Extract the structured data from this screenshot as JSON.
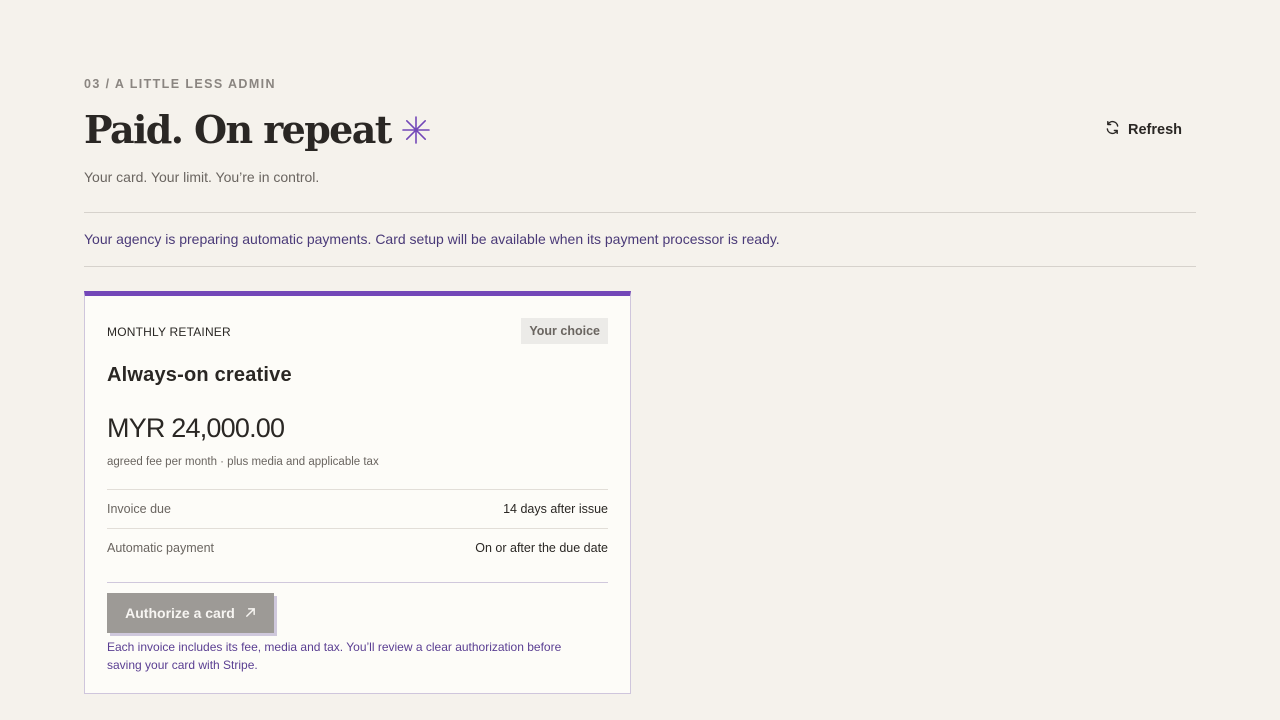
{
  "header": {
    "eyebrow": "03 / A LITTLE LESS ADMIN",
    "title": "Paid. On repeat",
    "title_icon": "asterisk-icon",
    "subtitle": "Your card. Your limit. You’re in control.",
    "refresh_label": "Refresh",
    "refresh_icon": "refresh-icon"
  },
  "notice": {
    "text": "Your agency is preparing automatic payments. Card setup will be available when its payment processor is ready."
  },
  "card": {
    "label": "MONTHLY RETAINER",
    "badge": "Your choice",
    "plan_name": "Always-on creative",
    "price": "MYR 24,000.00",
    "price_note": "agreed fee per month · plus media and applicable tax",
    "rows": [
      {
        "key": "Invoice due",
        "value": "14 days after issue"
      },
      {
        "key": "Automatic payment",
        "value": "On or after the due date"
      }
    ],
    "button_label": "Authorize a card",
    "button_icon": "arrow-up-right-icon",
    "footnote": "Each invoice includes its fee, media and tax. You’ll review a clear authorization before saving your card with Stripe."
  },
  "colors": {
    "background": "#f5f2ec",
    "accent": "#7347b8",
    "notice_text": "#4a3a78",
    "button_disabled": "#9d9a96"
  }
}
